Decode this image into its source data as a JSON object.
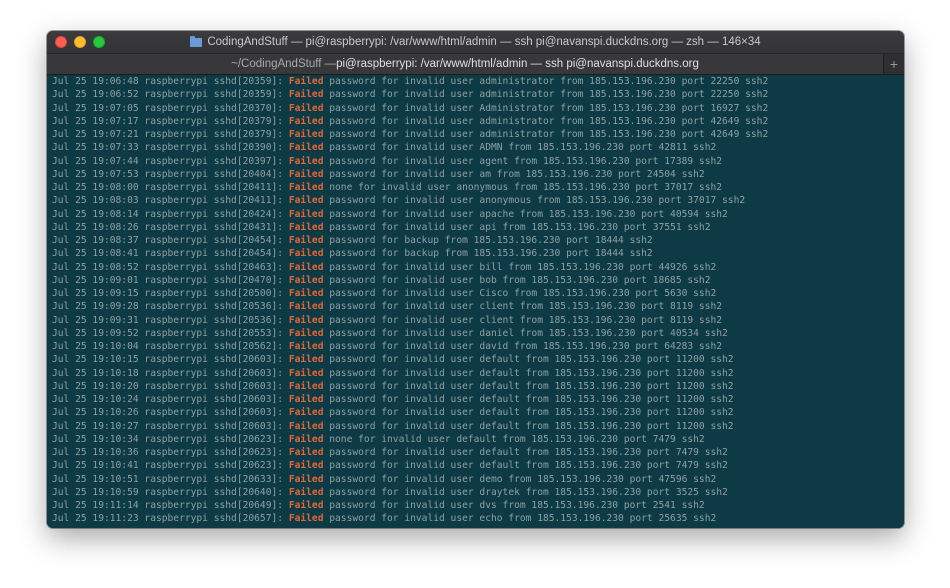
{
  "window": {
    "title": "CodingAndStuff — pi@raspberrypi: /var/www/html/admin — ssh pi@navanspi.duckdns.org — zsh — 146×34",
    "tab": {
      "path": "~/CodingAndStuff — ",
      "label": "pi@raspberrypi: /var/www/html/admin — ssh pi@navanspi.duckdns.org"
    },
    "new_tab_glyph": "+"
  },
  "colors": {
    "terminal_bg": "#0d3a45",
    "text": "#8ea1a3",
    "failed": "#e0673a"
  },
  "log": [
    {
      "prefix": "Jul 25 19:06:48 raspberrypi sshd[20359]: ",
      "status": "Failed",
      "message": " password for invalid user administrator from 185.153.196.230 port 22250 ssh2"
    },
    {
      "prefix": "Jul 25 19:06:52 raspberrypi sshd[20359]: ",
      "status": "Failed",
      "message": " password for invalid user administrator from 185.153.196.230 port 22250 ssh2"
    },
    {
      "prefix": "Jul 25 19:07:05 raspberrypi sshd[20370]: ",
      "status": "Failed",
      "message": " password for invalid user Administrator from 185.153.196.230 port 16927 ssh2"
    },
    {
      "prefix": "Jul 25 19:07:17 raspberrypi sshd[20379]: ",
      "status": "Failed",
      "message": " password for invalid user administrator from 185.153.196.230 port 42649 ssh2"
    },
    {
      "prefix": "Jul 25 19:07:21 raspberrypi sshd[20379]: ",
      "status": "Failed",
      "message": " password for invalid user administrator from 185.153.196.230 port 42649 ssh2"
    },
    {
      "prefix": "Jul 25 19:07:33 raspberrypi sshd[20390]: ",
      "status": "Failed",
      "message": " password for invalid user ADMN from 185.153.196.230 port 42811 ssh2"
    },
    {
      "prefix": "Jul 25 19:07:44 raspberrypi sshd[20397]: ",
      "status": "Failed",
      "message": " password for invalid user agent from 185.153.196.230 port 17389 ssh2"
    },
    {
      "prefix": "Jul 25 19:07:53 raspberrypi sshd[20404]: ",
      "status": "Failed",
      "message": " password for invalid user am from 185.153.196.230 port 24504 ssh2"
    },
    {
      "prefix": "Jul 25 19:08:00 raspberrypi sshd[20411]: ",
      "status": "Failed",
      "message": " none for invalid user anonymous from 185.153.196.230 port 37017 ssh2"
    },
    {
      "prefix": "Jul 25 19:08:03 raspberrypi sshd[20411]: ",
      "status": "Failed",
      "message": " password for invalid user anonymous from 185.153.196.230 port 37017 ssh2"
    },
    {
      "prefix": "Jul 25 19:08:14 raspberrypi sshd[20424]: ",
      "status": "Failed",
      "message": " password for invalid user apache from 185.153.196.230 port 40594 ssh2"
    },
    {
      "prefix": "Jul 25 19:08:26 raspberrypi sshd[20431]: ",
      "status": "Failed",
      "message": " password for invalid user api from 185.153.196.230 port 37551 ssh2"
    },
    {
      "prefix": "Jul 25 19:08:37 raspberrypi sshd[20454]: ",
      "status": "Failed",
      "message": " password for backup from 185.153.196.230 port 18444 ssh2"
    },
    {
      "prefix": "Jul 25 19:08:41 raspberrypi sshd[20454]: ",
      "status": "Failed",
      "message": " password for backup from 185.153.196.230 port 18444 ssh2"
    },
    {
      "prefix": "Jul 25 19:08:52 raspberrypi sshd[20463]: ",
      "status": "Failed",
      "message": " password for invalid user bill from 185.153.196.230 port 44926 ssh2"
    },
    {
      "prefix": "Jul 25 19:09:01 raspberrypi sshd[20470]: ",
      "status": "Failed",
      "message": " password for invalid user bob from 185.153.196.230 port 18685 ssh2"
    },
    {
      "prefix": "Jul 25 19:09:15 raspberrypi sshd[20500]: ",
      "status": "Failed",
      "message": " password for invalid user Cisco from 185.153.196.230 port 5630 ssh2"
    },
    {
      "prefix": "Jul 25 19:09:28 raspberrypi sshd[20536]: ",
      "status": "Failed",
      "message": " password for invalid user client from 185.153.196.230 port 8119 ssh2"
    },
    {
      "prefix": "Jul 25 19:09:31 raspberrypi sshd[20536]: ",
      "status": "Failed",
      "message": " password for invalid user client from 185.153.196.230 port 8119 ssh2"
    },
    {
      "prefix": "Jul 25 19:09:52 raspberrypi sshd[20553]: ",
      "status": "Failed",
      "message": " password for invalid user daniel from 185.153.196.230 port 40534 ssh2"
    },
    {
      "prefix": "Jul 25 19:10:04 raspberrypi sshd[20562]: ",
      "status": "Failed",
      "message": " password for invalid user david from 185.153.196.230 port 64283 ssh2"
    },
    {
      "prefix": "Jul 25 19:10:15 raspberrypi sshd[20603]: ",
      "status": "Failed",
      "message": " password for invalid user default from 185.153.196.230 port 11200 ssh2"
    },
    {
      "prefix": "Jul 25 19:10:18 raspberrypi sshd[20603]: ",
      "status": "Failed",
      "message": " password for invalid user default from 185.153.196.230 port 11200 ssh2"
    },
    {
      "prefix": "Jul 25 19:10:20 raspberrypi sshd[20603]: ",
      "status": "Failed",
      "message": " password for invalid user default from 185.153.196.230 port 11200 ssh2"
    },
    {
      "prefix": "Jul 25 19:10:24 raspberrypi sshd[20603]: ",
      "status": "Failed",
      "message": " password for invalid user default from 185.153.196.230 port 11200 ssh2"
    },
    {
      "prefix": "Jul 25 19:10:26 raspberrypi sshd[20603]: ",
      "status": "Failed",
      "message": " password for invalid user default from 185.153.196.230 port 11200 ssh2"
    },
    {
      "prefix": "Jul 25 19:10:27 raspberrypi sshd[20603]: ",
      "status": "Failed",
      "message": " password for invalid user default from 185.153.196.230 port 11200 ssh2"
    },
    {
      "prefix": "Jul 25 19:10:34 raspberrypi sshd[20623]: ",
      "status": "Failed",
      "message": " none for invalid user default from 185.153.196.230 port 7479 ssh2"
    },
    {
      "prefix": "Jul 25 19:10:36 raspberrypi sshd[20623]: ",
      "status": "Failed",
      "message": " password for invalid user default from 185.153.196.230 port 7479 ssh2"
    },
    {
      "prefix": "Jul 25 19:10:41 raspberrypi sshd[20623]: ",
      "status": "Failed",
      "message": " password for invalid user default from 185.153.196.230 port 7479 ssh2"
    },
    {
      "prefix": "Jul 25 19:10:51 raspberrypi sshd[20633]: ",
      "status": "Failed",
      "message": " password for invalid user demo from 185.153.196.230 port 47596 ssh2"
    },
    {
      "prefix": "Jul 25 19:10:59 raspberrypi sshd[20640]: ",
      "status": "Failed",
      "message": " password for invalid user draytek from 185.153.196.230 port 3525 ssh2"
    },
    {
      "prefix": "Jul 25 19:11:14 raspberrypi sshd[20649]: ",
      "status": "Failed",
      "message": " password for invalid user dvs from 185.153.196.230 port 2541 ssh2"
    },
    {
      "prefix": "Jul 25 19:11:23 raspberrypi sshd[20657]: ",
      "status": "Failed",
      "message": " password for invalid user echo from 185.153.196.230 port 25635 ssh2"
    }
  ]
}
